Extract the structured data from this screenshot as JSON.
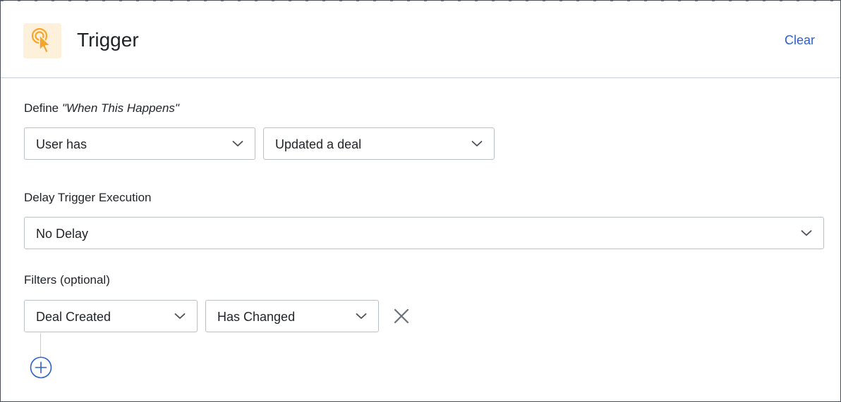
{
  "header": {
    "title": "Trigger",
    "clear_label": "Clear",
    "icon": "tap-pointer-icon"
  },
  "define": {
    "label_prefix": "Define ",
    "label_emphasis": "\"When This Happens\"",
    "subject_select": {
      "value": "User has"
    },
    "action_select": {
      "value": "Updated a deal"
    }
  },
  "delay": {
    "label": "Delay Trigger Execution",
    "select": {
      "value": "No Delay"
    }
  },
  "filters": {
    "label": "Filters (optional)",
    "items": [
      {
        "field_select": {
          "value": "Deal Created"
        },
        "condition_select": {
          "value": "Has Changed"
        }
      }
    ]
  },
  "colors": {
    "accent": "#2b62c9",
    "icon_orange": "#f4a62a",
    "icon_bg": "#fdf1dc",
    "border": "#b9bfc7"
  }
}
